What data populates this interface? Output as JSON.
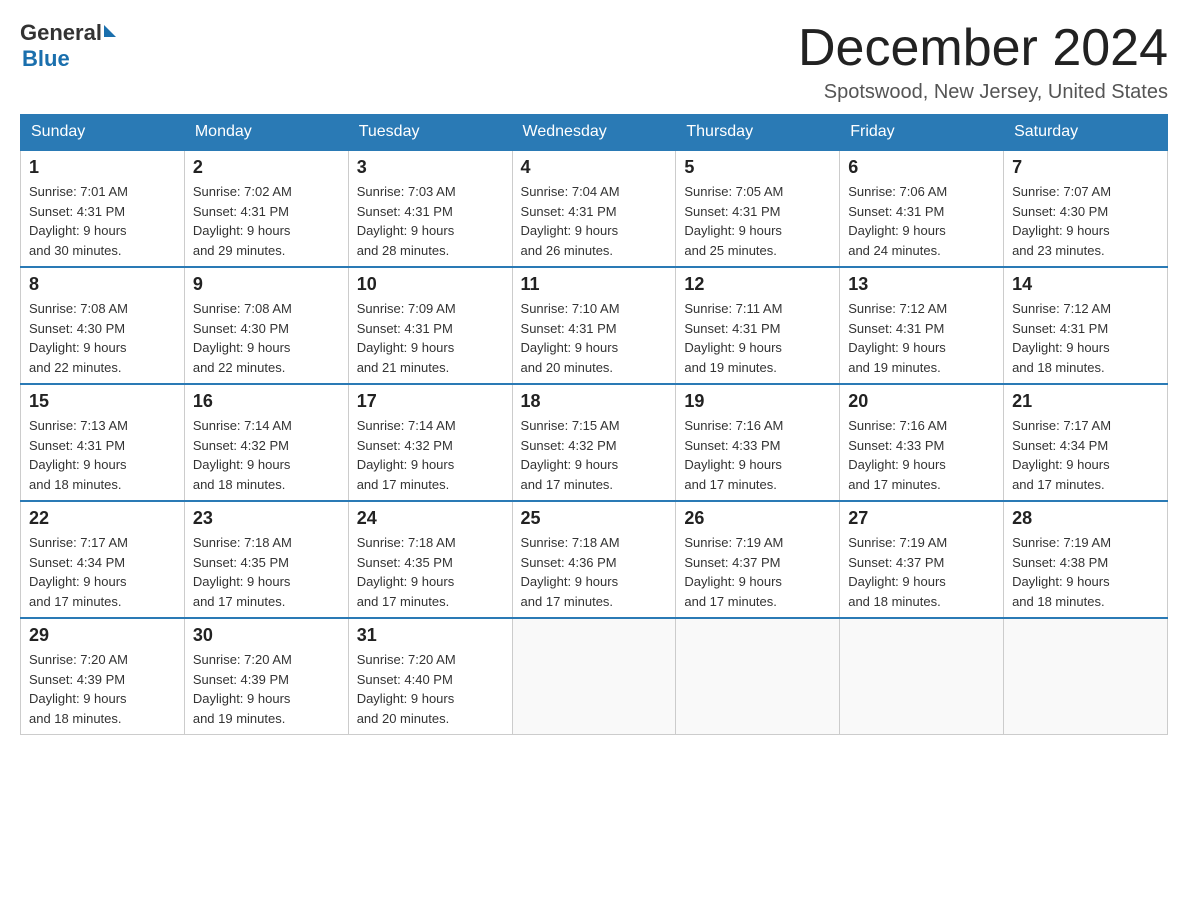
{
  "header": {
    "logo_general": "General",
    "logo_blue": "Blue",
    "month_title": "December 2024",
    "location": "Spotswood, New Jersey, United States"
  },
  "weekdays": [
    "Sunday",
    "Monday",
    "Tuesday",
    "Wednesday",
    "Thursday",
    "Friday",
    "Saturday"
  ],
  "weeks": [
    [
      {
        "day": "1",
        "sunrise": "7:01 AM",
        "sunset": "4:31 PM",
        "daylight": "9 hours and 30 minutes."
      },
      {
        "day": "2",
        "sunrise": "7:02 AM",
        "sunset": "4:31 PM",
        "daylight": "9 hours and 29 minutes."
      },
      {
        "day": "3",
        "sunrise": "7:03 AM",
        "sunset": "4:31 PM",
        "daylight": "9 hours and 28 minutes."
      },
      {
        "day": "4",
        "sunrise": "7:04 AM",
        "sunset": "4:31 PM",
        "daylight": "9 hours and 26 minutes."
      },
      {
        "day": "5",
        "sunrise": "7:05 AM",
        "sunset": "4:31 PM",
        "daylight": "9 hours and 25 minutes."
      },
      {
        "day": "6",
        "sunrise": "7:06 AM",
        "sunset": "4:31 PM",
        "daylight": "9 hours and 24 minutes."
      },
      {
        "day": "7",
        "sunrise": "7:07 AM",
        "sunset": "4:30 PM",
        "daylight": "9 hours and 23 minutes."
      }
    ],
    [
      {
        "day": "8",
        "sunrise": "7:08 AM",
        "sunset": "4:30 PM",
        "daylight": "9 hours and 22 minutes."
      },
      {
        "day": "9",
        "sunrise": "7:08 AM",
        "sunset": "4:30 PM",
        "daylight": "9 hours and 22 minutes."
      },
      {
        "day": "10",
        "sunrise": "7:09 AM",
        "sunset": "4:31 PM",
        "daylight": "9 hours and 21 minutes."
      },
      {
        "day": "11",
        "sunrise": "7:10 AM",
        "sunset": "4:31 PM",
        "daylight": "9 hours and 20 minutes."
      },
      {
        "day": "12",
        "sunrise": "7:11 AM",
        "sunset": "4:31 PM",
        "daylight": "9 hours and 19 minutes."
      },
      {
        "day": "13",
        "sunrise": "7:12 AM",
        "sunset": "4:31 PM",
        "daylight": "9 hours and 19 minutes."
      },
      {
        "day": "14",
        "sunrise": "7:12 AM",
        "sunset": "4:31 PM",
        "daylight": "9 hours and 18 minutes."
      }
    ],
    [
      {
        "day": "15",
        "sunrise": "7:13 AM",
        "sunset": "4:31 PM",
        "daylight": "9 hours and 18 minutes."
      },
      {
        "day": "16",
        "sunrise": "7:14 AM",
        "sunset": "4:32 PM",
        "daylight": "9 hours and 18 minutes."
      },
      {
        "day": "17",
        "sunrise": "7:14 AM",
        "sunset": "4:32 PM",
        "daylight": "9 hours and 17 minutes."
      },
      {
        "day": "18",
        "sunrise": "7:15 AM",
        "sunset": "4:32 PM",
        "daylight": "9 hours and 17 minutes."
      },
      {
        "day": "19",
        "sunrise": "7:16 AM",
        "sunset": "4:33 PM",
        "daylight": "9 hours and 17 minutes."
      },
      {
        "day": "20",
        "sunrise": "7:16 AM",
        "sunset": "4:33 PM",
        "daylight": "9 hours and 17 minutes."
      },
      {
        "day": "21",
        "sunrise": "7:17 AM",
        "sunset": "4:34 PM",
        "daylight": "9 hours and 17 minutes."
      }
    ],
    [
      {
        "day": "22",
        "sunrise": "7:17 AM",
        "sunset": "4:34 PM",
        "daylight": "9 hours and 17 minutes."
      },
      {
        "day": "23",
        "sunrise": "7:18 AM",
        "sunset": "4:35 PM",
        "daylight": "9 hours and 17 minutes."
      },
      {
        "day": "24",
        "sunrise": "7:18 AM",
        "sunset": "4:35 PM",
        "daylight": "9 hours and 17 minutes."
      },
      {
        "day": "25",
        "sunrise": "7:18 AM",
        "sunset": "4:36 PM",
        "daylight": "9 hours and 17 minutes."
      },
      {
        "day": "26",
        "sunrise": "7:19 AM",
        "sunset": "4:37 PM",
        "daylight": "9 hours and 17 minutes."
      },
      {
        "day": "27",
        "sunrise": "7:19 AM",
        "sunset": "4:37 PM",
        "daylight": "9 hours and 18 minutes."
      },
      {
        "day": "28",
        "sunrise": "7:19 AM",
        "sunset": "4:38 PM",
        "daylight": "9 hours and 18 minutes."
      }
    ],
    [
      {
        "day": "29",
        "sunrise": "7:20 AM",
        "sunset": "4:39 PM",
        "daylight": "9 hours and 18 minutes."
      },
      {
        "day": "30",
        "sunrise": "7:20 AM",
        "sunset": "4:39 PM",
        "daylight": "9 hours and 19 minutes."
      },
      {
        "day": "31",
        "sunrise": "7:20 AM",
        "sunset": "4:40 PM",
        "daylight": "9 hours and 20 minutes."
      },
      null,
      null,
      null,
      null
    ]
  ],
  "labels": {
    "sunrise": "Sunrise:",
    "sunset": "Sunset:",
    "daylight": "Daylight:"
  }
}
